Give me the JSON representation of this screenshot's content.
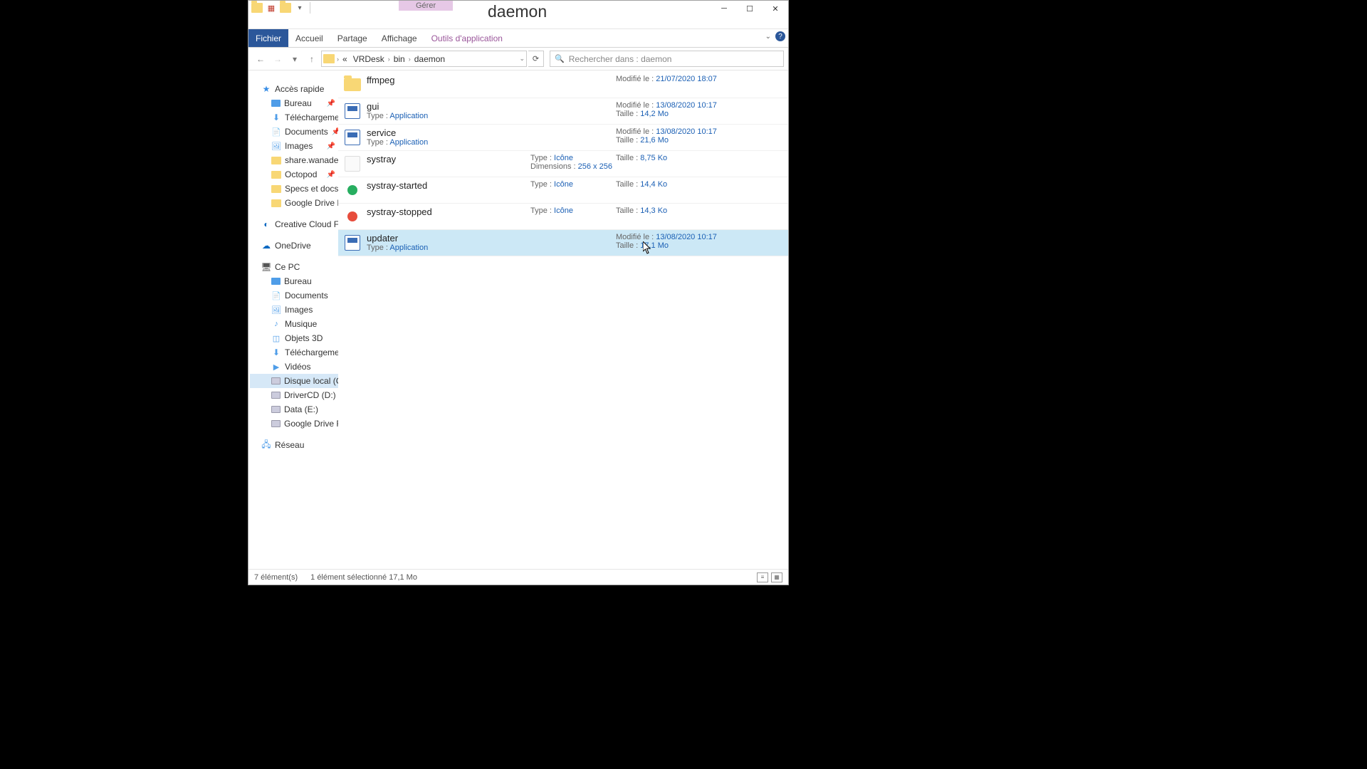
{
  "window": {
    "title": "daemon",
    "context_tab_header": "Gérer"
  },
  "ribbon": {
    "file": "Fichier",
    "tabs": [
      "Accueil",
      "Partage",
      "Affichage"
    ],
    "context_tab": "Outils d'application"
  },
  "breadcrumb": {
    "prefix": "«",
    "segments": [
      "VRDesk",
      "bin",
      "daemon"
    ]
  },
  "search": {
    "placeholder": "Rechercher dans : daemon"
  },
  "labels": {
    "type": "Type :",
    "modified": "Modifié le :",
    "size": "Taille :",
    "dimensions": "Dimensions :"
  },
  "sidebar": {
    "quick_access": "Accès rapide",
    "quick_items": [
      {
        "label": "Bureau",
        "icon": "desktop",
        "pinned": true
      },
      {
        "label": "Téléchargements",
        "icon": "download",
        "pinned": true
      },
      {
        "label": "Documents",
        "icon": "doc",
        "pinned": true
      },
      {
        "label": "Images",
        "icon": "img",
        "pinned": true
      },
      {
        "label": "share.wanadev.la",
        "icon": "folder",
        "pinned": true
      },
      {
        "label": "Octopod",
        "icon": "folder",
        "pinned": true
      },
      {
        "label": "Specs et docs sal",
        "icon": "folder",
        "pinned": true
      },
      {
        "label": "Google Drive File",
        "icon": "folder",
        "pinned": true
      }
    ],
    "creative": "Creative Cloud Files",
    "onedrive": "OneDrive",
    "this_pc": "Ce PC",
    "pc_items": [
      {
        "label": "Bureau",
        "icon": "desktop"
      },
      {
        "label": "Documents",
        "icon": "doc"
      },
      {
        "label": "Images",
        "icon": "img"
      },
      {
        "label": "Musique",
        "icon": "music"
      },
      {
        "label": "Objets 3D",
        "icon": "3d"
      },
      {
        "label": "Téléchargements",
        "icon": "download"
      },
      {
        "label": "Vidéos",
        "icon": "video"
      },
      {
        "label": "Disque local (C:)",
        "icon": "disk",
        "selected": true
      },
      {
        "label": "DriverCD (D:)",
        "icon": "disk"
      },
      {
        "label": "Data (E:)",
        "icon": "disk"
      },
      {
        "label": "Google Drive File St",
        "icon": "disk"
      }
    ],
    "network": "Réseau"
  },
  "files": [
    {
      "name": "ffmpeg",
      "icon": "folder",
      "modified": "21/07/2020 18:07"
    },
    {
      "name": "gui",
      "icon": "exe",
      "type_val": "Application",
      "modified": "13/08/2020 10:17",
      "size": "14,2 Mo"
    },
    {
      "name": "service",
      "icon": "exe",
      "type_val": "Application",
      "modified": "13/08/2020 10:17",
      "size": "21,6 Mo"
    },
    {
      "name": "systray",
      "icon": "blank",
      "mid_type": "Icône",
      "dimensions": "256 x 256",
      "size": "8,75 Ko"
    },
    {
      "name": "systray-started",
      "icon": "green",
      "mid_type": "Icône",
      "size": "14,4 Ko"
    },
    {
      "name": "systray-stopped",
      "icon": "red",
      "mid_type": "Icône",
      "size": "14,3 Ko"
    },
    {
      "name": "updater",
      "icon": "exe",
      "type_val": "Application",
      "modified": "13/08/2020 10:17",
      "size": "17,1 Mo",
      "selected": true
    }
  ],
  "statusbar": {
    "count": "7 élément(s)",
    "selection": "1 élément sélectionné 17,1 Mo"
  }
}
